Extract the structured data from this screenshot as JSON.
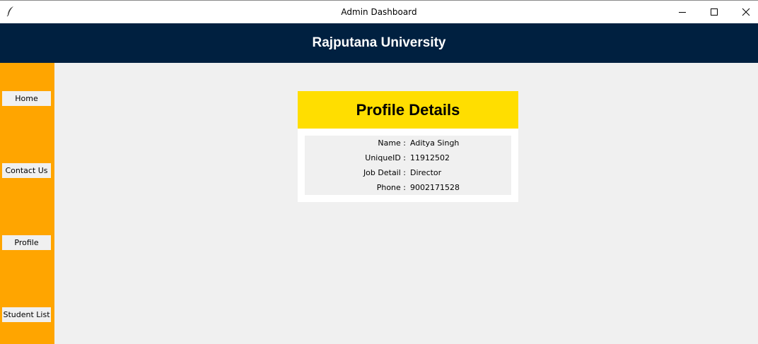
{
  "window": {
    "title": "Admin Dashboard",
    "icons": {
      "app": "feather-icon",
      "minimize": "minimize-icon",
      "maximize": "maximize-icon",
      "close": "close-icon"
    }
  },
  "header": {
    "title": "Rajputana University"
  },
  "sidebar": {
    "items": [
      {
        "label": "Home"
      },
      {
        "label": "Contact Us"
      },
      {
        "label": "Profile"
      },
      {
        "label": "Student List"
      }
    ]
  },
  "profile": {
    "heading": "Profile Details",
    "fields": [
      {
        "label": "Name :",
        "value": "Aditya Singh"
      },
      {
        "label": "UniqueID :",
        "value": "11912502"
      },
      {
        "label": "Job Detail :",
        "value": "Director"
      },
      {
        "label": "Phone :",
        "value": "9002171528"
      }
    ]
  },
  "colors": {
    "header_bg": "#002040",
    "sidebar_bg": "#ffa500",
    "title_bg": "#ffde00",
    "content_bg": "#f0f0f0"
  }
}
